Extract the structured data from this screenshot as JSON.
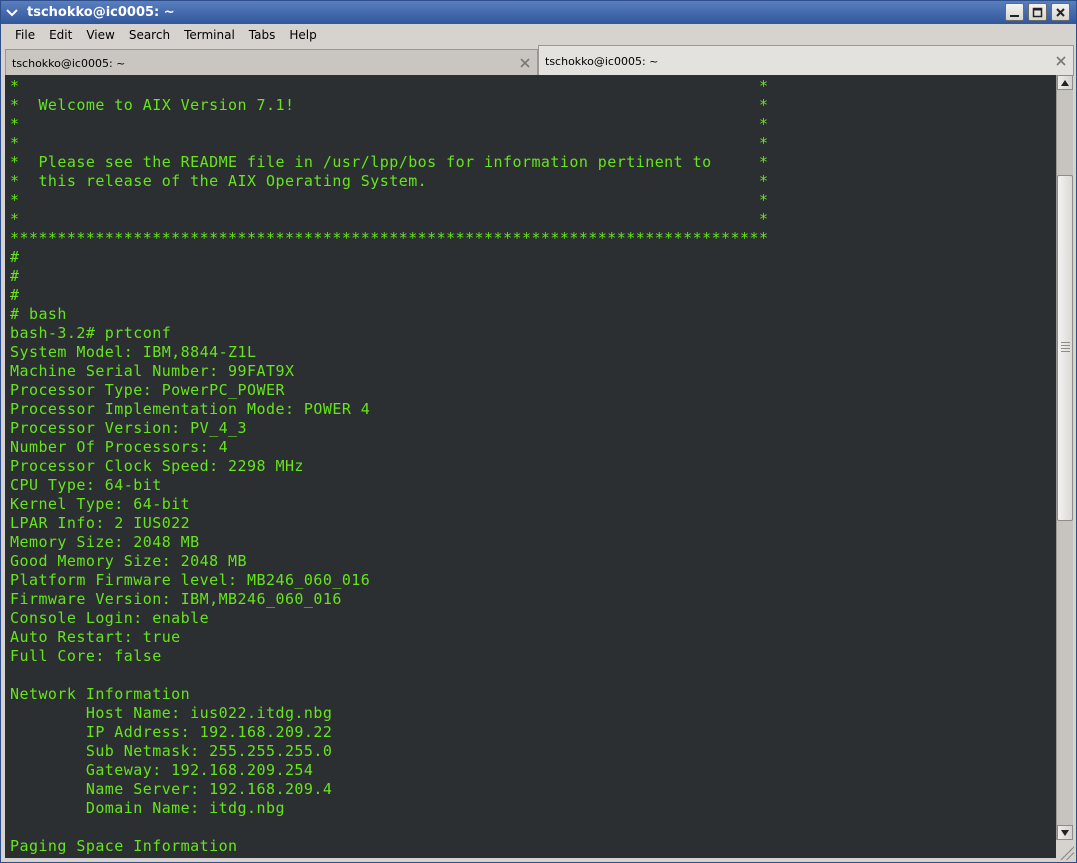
{
  "window": {
    "title": "tschokko@ic0005: ~"
  },
  "menubar": {
    "items": [
      "File",
      "Edit",
      "View",
      "Search",
      "Terminal",
      "Tabs",
      "Help"
    ]
  },
  "tabs": [
    {
      "label": "tschokko@ic0005: ~",
      "active": false
    },
    {
      "label": "tschokko@ic0005: ~",
      "active": true
    }
  ],
  "terminal": {
    "fg_color": "#66e41c",
    "bg_color": "#2b2f31",
    "lines": [
      "*                                                                              *",
      "*  Welcome to AIX Version 7.1!                                                 *",
      "*                                                                              *",
      "*                                                                              *",
      "*  Please see the README file in /usr/lpp/bos for information pertinent to     *",
      "*  this release of the AIX Operating System.                                   *",
      "*                                                                              *",
      "*                                                                              *",
      "********************************************************************************",
      "#",
      "#",
      "#",
      "# bash",
      "bash-3.2# prtconf",
      "System Model: IBM,8844-Z1L",
      "Machine Serial Number: 99FAT9X",
      "Processor Type: PowerPC_POWER",
      "Processor Implementation Mode: POWER 4",
      "Processor Version: PV_4_3",
      "Number Of Processors: 4",
      "Processor Clock Speed: 2298 MHz",
      "CPU Type: 64-bit",
      "Kernel Type: 64-bit",
      "LPAR Info: 2 IUS022",
      "Memory Size: 2048 MB",
      "Good Memory Size: 2048 MB",
      "Platform Firmware level: MB246_060_016",
      "Firmware Version: IBM,MB246_060_016",
      "Console Login: enable",
      "Auto Restart: true",
      "Full Core: false",
      "",
      "Network Information",
      "        Host Name: ius022.itdg.nbg",
      "        IP Address: 192.168.209.22",
      "        Sub Netmask: 255.255.255.0",
      "        Gateway: 192.168.209.254",
      "        Name Server: 192.168.209.4",
      "        Domain Name: itdg.nbg",
      "",
      "Paging Space Information"
    ]
  },
  "icons": {
    "window_menu": "chevron-down-icon",
    "minimize": "minimize-icon",
    "maximize": "maximize-icon",
    "close": "close-icon",
    "tab_close": "close-icon"
  }
}
